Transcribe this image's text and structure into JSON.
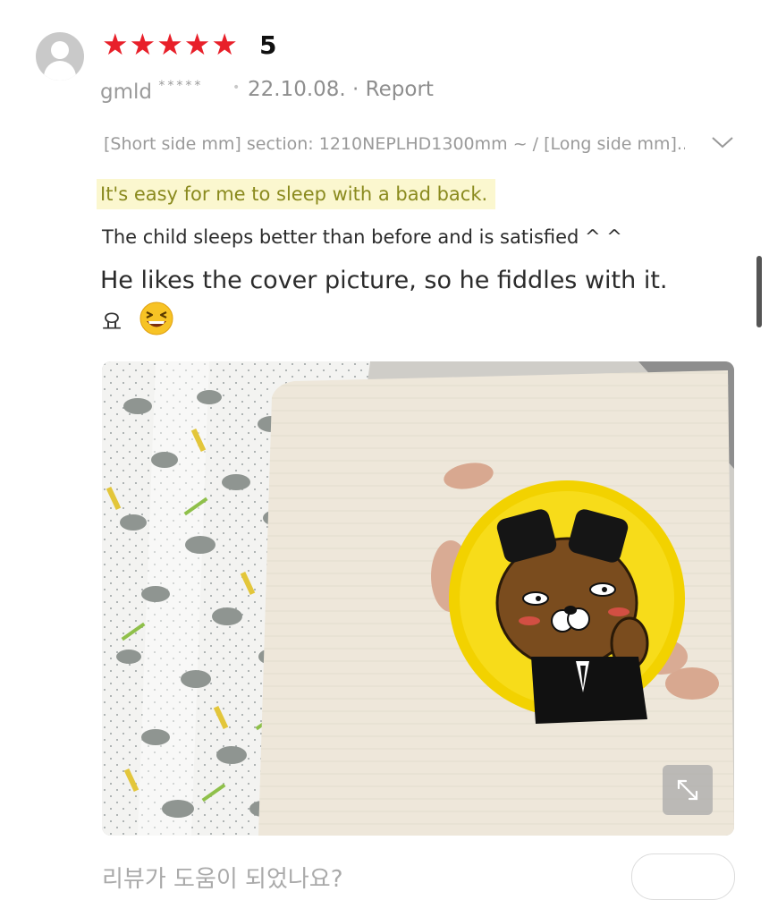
{
  "review": {
    "rating": "5",
    "star_count": 5,
    "reviewer_name": "gmld",
    "reviewer_mask": "*****",
    "date": "22.10.08.",
    "report_label": "· Report",
    "option_text": "[Short side mm] section: 1210NEPLHD1300mm ~ / [Long side mm]...",
    "text_highlight": "It's easy for me to sleep with a bad back.",
    "text_line2": "The child sleeps better than before and is satisfied ^ ^",
    "text_line3": "He likes the cover picture, so he fiddles with it.",
    "text_line4": "요"
  },
  "colors": {
    "star": "#e8202a",
    "highlight_bg": "#fbf7cf",
    "highlight_text": "#8a8a1e"
  },
  "icons": {
    "avatar": "default-user-avatar-icon",
    "expand": "expand-arrows-icon",
    "dropdown": "chevron-down-icon",
    "emoji": "grinning-squint-face-emoji"
  },
  "bottom_partial_text": "리뷰가 도움이 되었나요?"
}
